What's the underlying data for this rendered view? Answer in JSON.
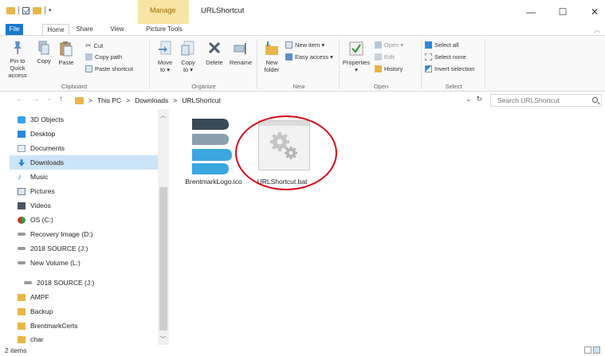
{
  "window": {
    "title": "URLShortcut",
    "contextual_tab_group": "Manage",
    "minimize": "—",
    "maximize": "☐",
    "close": "✕"
  },
  "ribbon_tabs": [
    "File",
    "Home",
    "Share",
    "View",
    "Picture Tools"
  ],
  "ribbon": {
    "clipboard": {
      "label": "Clipboard",
      "pin": [
        "Pin to Quick",
        "access"
      ],
      "copy": "Copy",
      "paste": "Paste",
      "cut": "Cut",
      "copy_path": "Copy path",
      "paste_shortcut": "Paste shortcut"
    },
    "organize": {
      "label": "Organize",
      "move_to": [
        "Move",
        "to ▾"
      ],
      "copy_to": [
        "Copy",
        "to ▾"
      ],
      "delete": "Delete",
      "rename": "Rename"
    },
    "new": {
      "label": "New",
      "new_folder": [
        "New",
        "folder"
      ],
      "new_item": "New item ▾",
      "easy_access": "Easy access ▾"
    },
    "open": {
      "label": "Open",
      "properties": [
        "Properties",
        "▾"
      ],
      "open": "Open ▾",
      "edit": "Edit",
      "history": "History"
    },
    "select": {
      "label": "Select",
      "select_all": "Select all",
      "select_none": "Select none",
      "invert_selection": "Invert selection"
    }
  },
  "address_bar": {
    "back": "←",
    "forward": "→",
    "recent": "⌄",
    "up": "↑",
    "path": [
      "This PC",
      "Downloads",
      "URLShortcut"
    ],
    "separator": ">",
    "dropdown": "⌄",
    "refresh": "↻",
    "search_placeholder": "Search URLShortcut"
  },
  "sidebar": {
    "items": [
      {
        "label": "3D Objects",
        "icon": "3d-objects-icon",
        "color": "#3aa0e8"
      },
      {
        "label": "Desktop",
        "icon": "desktop-icon",
        "color": "#2b88d8"
      },
      {
        "label": "Documents",
        "icon": "documents-icon",
        "color": "#8a9bb0"
      },
      {
        "label": "Downloads",
        "icon": "downloads-icon",
        "color": "#2b88d8",
        "selected": true
      },
      {
        "label": "Music",
        "icon": "music-icon",
        "color": "#2b88d8"
      },
      {
        "label": "Pictures",
        "icon": "pictures-icon",
        "color": "#6a7b8d"
      },
      {
        "label": "Videos",
        "icon": "videos-icon",
        "color": "#4b5563"
      },
      {
        "label": "OS (C:)",
        "icon": "drive-c-icon",
        "color": "#c0392b"
      },
      {
        "label": "Recovery Image (D:)",
        "icon": "drive-icon",
        "color": "#9a9a9a"
      },
      {
        "label": "2018 SOURCE (J:)",
        "icon": "drive-icon",
        "color": "#9a9a9a"
      },
      {
        "label": "New Volume (L:)",
        "icon": "drive-icon",
        "color": "#9a9a9a"
      }
    ],
    "drive_section": {
      "label": "2018 SOURCE (J:)",
      "icon": "drive-icon"
    },
    "folders": [
      "AMPF",
      "Backup",
      "BrentmarkCerts",
      "char"
    ]
  },
  "files": [
    {
      "name": "BrentmarkLogo.ico",
      "icon": "brentmark-logo-icon"
    },
    {
      "name": "URLShortcut.bat",
      "icon": "batch-file-icon"
    }
  ],
  "status": {
    "item_count": "2 items"
  },
  "colors": {
    "accent": "#1979ca",
    "manage_tab": "#f8e4a4",
    "selection": "#cce4f7",
    "annotation": "#d40a16",
    "folder": "#e8b64a"
  }
}
